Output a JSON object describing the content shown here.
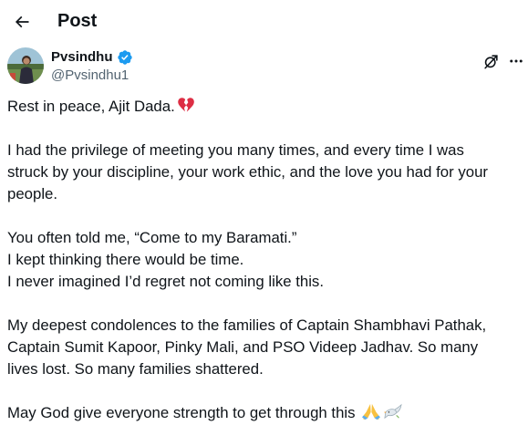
{
  "header": {
    "back_icon": "arrow-left-icon",
    "title": "Post"
  },
  "author": {
    "name": "Pvsindhu",
    "handle": "@Pvsindhu1",
    "verified_icon": "verified-badge-icon",
    "verified_color": "#1d9bf0",
    "avatar_icon": "avatar-photo"
  },
  "actions": {
    "grok_icon": "grok-icon",
    "more_icon": "more-options-icon"
  },
  "tweet": {
    "p1_line1": "Rest in peace, Ajit Dada.",
    "p1_emoji": "broken-heart-icon",
    "p2_line1": "I had the privilege of meeting you many times, and every time I was",
    "p2_line2": "struck by your discipline, your work ethic, and the love you had for your",
    "p2_line3": "people.",
    "p3_line1": "You often told me, “Come to my Baramati.”",
    "p3_line2": "I kept thinking there would be time.",
    "p3_line3": "I never imagined I’d regret not coming like this.",
    "p4_line1": "My deepest condolences to the families of Captain Shambhavi Pathak,",
    "p4_line2": "Captain Sumit Kapoor, Pinky Mali, and PSO Videep Jadhav. So many",
    "p4_line3": "lives lost. So many families shattered.",
    "p5_line1": "May God give everyone strength to get through this",
    "p5_emoji1": "folded-hands-icon",
    "p5_emoji2": "dove-icon"
  },
  "colors": {
    "text": "#0f1419",
    "secondary": "#536471",
    "accent": "#1d9bf0",
    "heart": "#e0245e"
  }
}
